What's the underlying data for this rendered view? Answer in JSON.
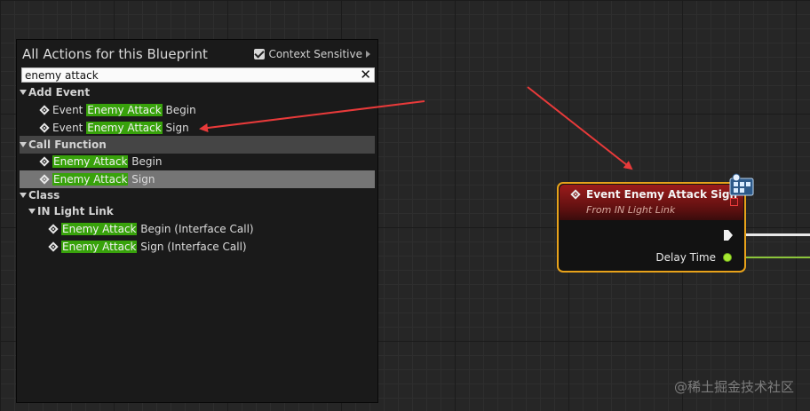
{
  "panel": {
    "title": "All Actions for this Blueprint",
    "context_sensitive_label": "Context Sensitive",
    "context_sensitive_checked": true,
    "search": {
      "value": "enemy attack",
      "clear_icon": "close-icon"
    },
    "tree": {
      "add_event": {
        "label": "Add Event",
        "items": [
          {
            "prefix": "Event ",
            "highlight": "Enemy Attack",
            "suffix": " Begin"
          },
          {
            "prefix": "Event ",
            "highlight": "Enemy Attack",
            "suffix": " Sign"
          }
        ]
      },
      "call_function": {
        "label": "Call Function",
        "items": [
          {
            "prefix": "",
            "highlight": "Enemy Attack",
            "suffix": " Begin"
          },
          {
            "prefix": "",
            "highlight": "Enemy Attack",
            "suffix": " Sign"
          }
        ]
      },
      "class": {
        "label": "Class",
        "subcategory": {
          "label": "IN Light Link",
          "items": [
            {
              "prefix": "",
              "highlight": "Enemy Attack",
              "suffix": " Begin (Interface Call)"
            },
            {
              "prefix": "",
              "highlight": "Enemy Attack",
              "suffix": " Sign (Interface Call)"
            }
          ]
        }
      }
    }
  },
  "node": {
    "title": "Event Enemy Attack Sign",
    "subtitle": "From IN Light Link",
    "output_pin_label": "Delay Time",
    "header_color": "#9b1b1b",
    "border_color": "#e8a21a",
    "pin_color": "#a6e832"
  },
  "watermark": "@稀土掘金技术社区",
  "colors": {
    "match_highlight": "#38a20b",
    "selection": "#757575",
    "annotation_arrow": "#e83a3a"
  }
}
